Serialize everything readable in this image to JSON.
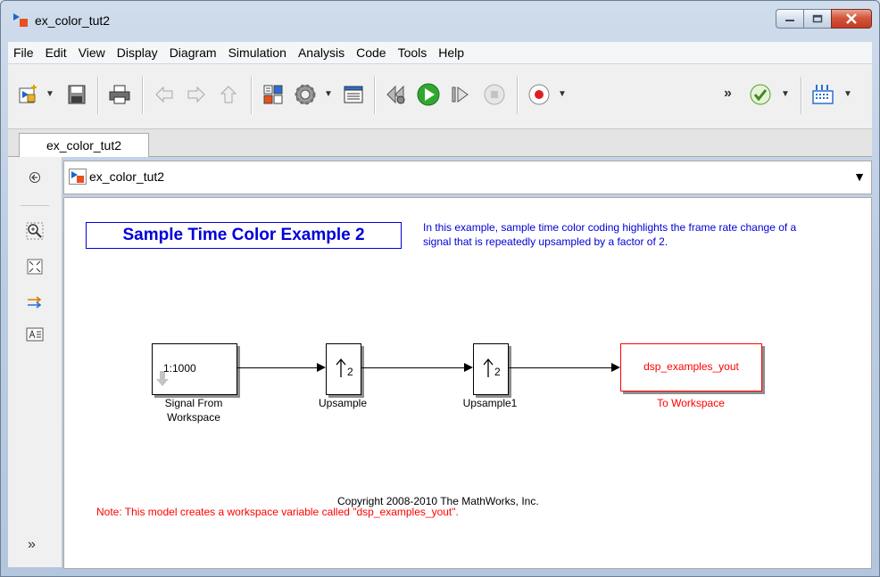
{
  "window": {
    "title": "ex_color_tut2"
  },
  "menu": [
    "File",
    "Edit",
    "View",
    "Display",
    "Diagram",
    "Simulation",
    "Analysis",
    "Code",
    "Tools",
    "Help"
  ],
  "tab": {
    "label": "ex_color_tut2"
  },
  "address": {
    "path": "ex_color_tut2"
  },
  "toolbar": {
    "overflow_glyph": "»"
  },
  "palette": {
    "expand_glyph": "»"
  },
  "model": {
    "title": "Sample Time Color Example 2",
    "description": "In this example, sample time color coding highlights the frame rate change of a signal that is repeatedly upsampled by a factor of 2.",
    "blocks": {
      "source": {
        "content": "1:1000",
        "label_line1": "Signal From",
        "label_line2": "Workspace"
      },
      "upsample": {
        "content": "2",
        "label": "Upsample"
      },
      "upsample1": {
        "content": "2",
        "label": "Upsample1"
      },
      "sink": {
        "content": "dsp_examples_yout",
        "label": "To Workspace"
      }
    },
    "copyright": "Copyright 2008-2010 The MathWorks, Inc.",
    "note": "Note: This model creates a workspace variable called \"dsp_examples_yout\"."
  },
  "colors": {
    "annotation_blue": "#0000d8",
    "sample_time_red": "#ff0000",
    "run_green": "#2fa82f"
  }
}
